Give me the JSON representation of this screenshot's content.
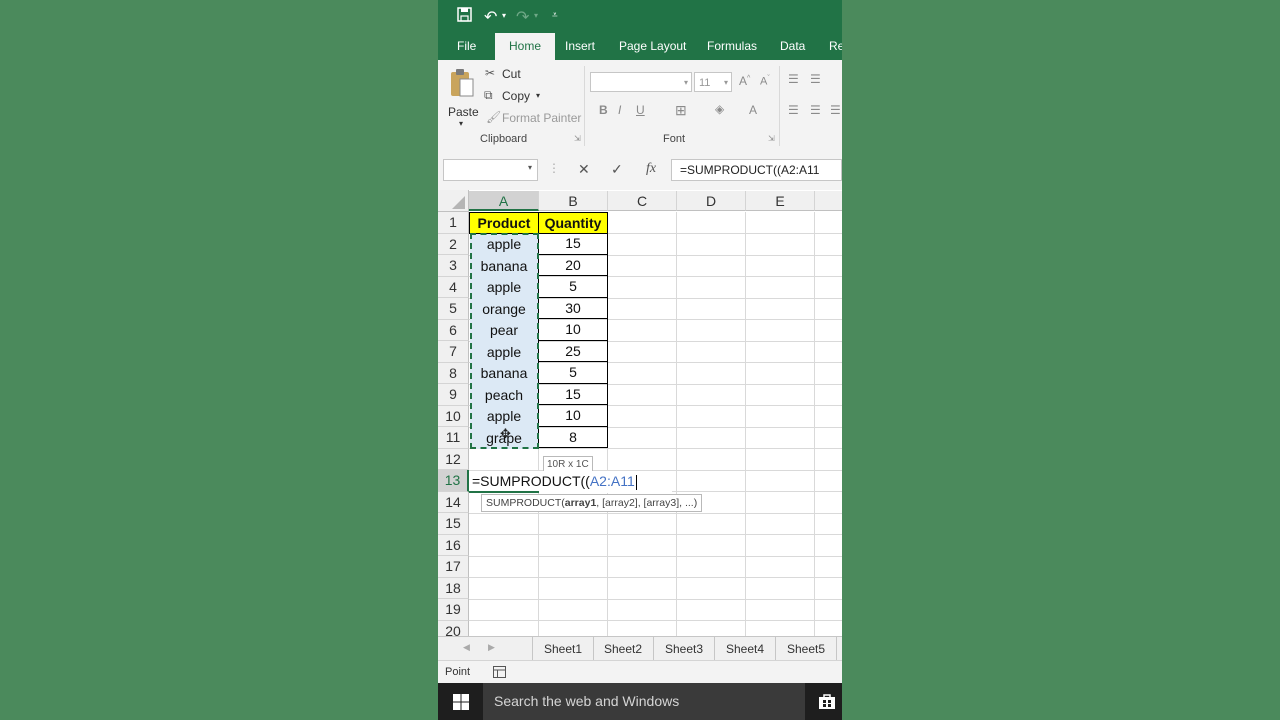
{
  "quick_access": {
    "save_icon": "save-icon",
    "undo_icon": "undo-icon",
    "redo_icon": "redo-icon",
    "customize_icon": "customize-icon"
  },
  "tabs": [
    "File",
    "Home",
    "Insert",
    "Page Layout",
    "Formulas",
    "Data",
    "Re"
  ],
  "ribbon": {
    "paste_label": "Paste",
    "cut_label": "Cut",
    "copy_label": "Copy",
    "format_painter_label": "Format Painter",
    "clipboard_group": "Clipboard",
    "font_group": "Font",
    "font_size": "11"
  },
  "formula_bar": {
    "name_box": "",
    "cancel": "✕",
    "enter": "✓",
    "fx": "fx",
    "content": "=SUMPRODUCT((A2:A11"
  },
  "columns": [
    "A",
    "B",
    "C",
    "D",
    "E"
  ],
  "rows": [
    "1",
    "2",
    "3",
    "4",
    "5",
    "6",
    "7",
    "8",
    "9",
    "10",
    "11",
    "12",
    "13",
    "14",
    "15",
    "16",
    "17",
    "18",
    "19",
    "20"
  ],
  "table": {
    "header": [
      "Product",
      "Quantity"
    ],
    "rows": [
      [
        "apple",
        "15"
      ],
      [
        "banana",
        "20"
      ],
      [
        "apple",
        "5"
      ],
      [
        "orange",
        "30"
      ],
      [
        "pear",
        "10"
      ],
      [
        "apple",
        "25"
      ],
      [
        "banana",
        "5"
      ],
      [
        "peach",
        "15"
      ],
      [
        "apple",
        "10"
      ],
      [
        "grape",
        "8"
      ]
    ]
  },
  "editing": {
    "prefix": "=SUMPRODUCT((",
    "ref": "A2:A11",
    "range_tooltip": "10R x 1C",
    "func_name": "SUMPRODUCT(",
    "func_arg1": "array1",
    "func_rest": ", [array2], [array3], ...)"
  },
  "sheets": [
    "Sheet1",
    "Sheet2",
    "Sheet3",
    "Sheet4",
    "Sheet5"
  ],
  "status": {
    "mode": "Point"
  },
  "taskbar": {
    "search_placeholder": "Search the web and Windows"
  },
  "colors": {
    "excel_green": "#217346",
    "header_fill": "#ffff00",
    "background": "#4b8a5c"
  }
}
